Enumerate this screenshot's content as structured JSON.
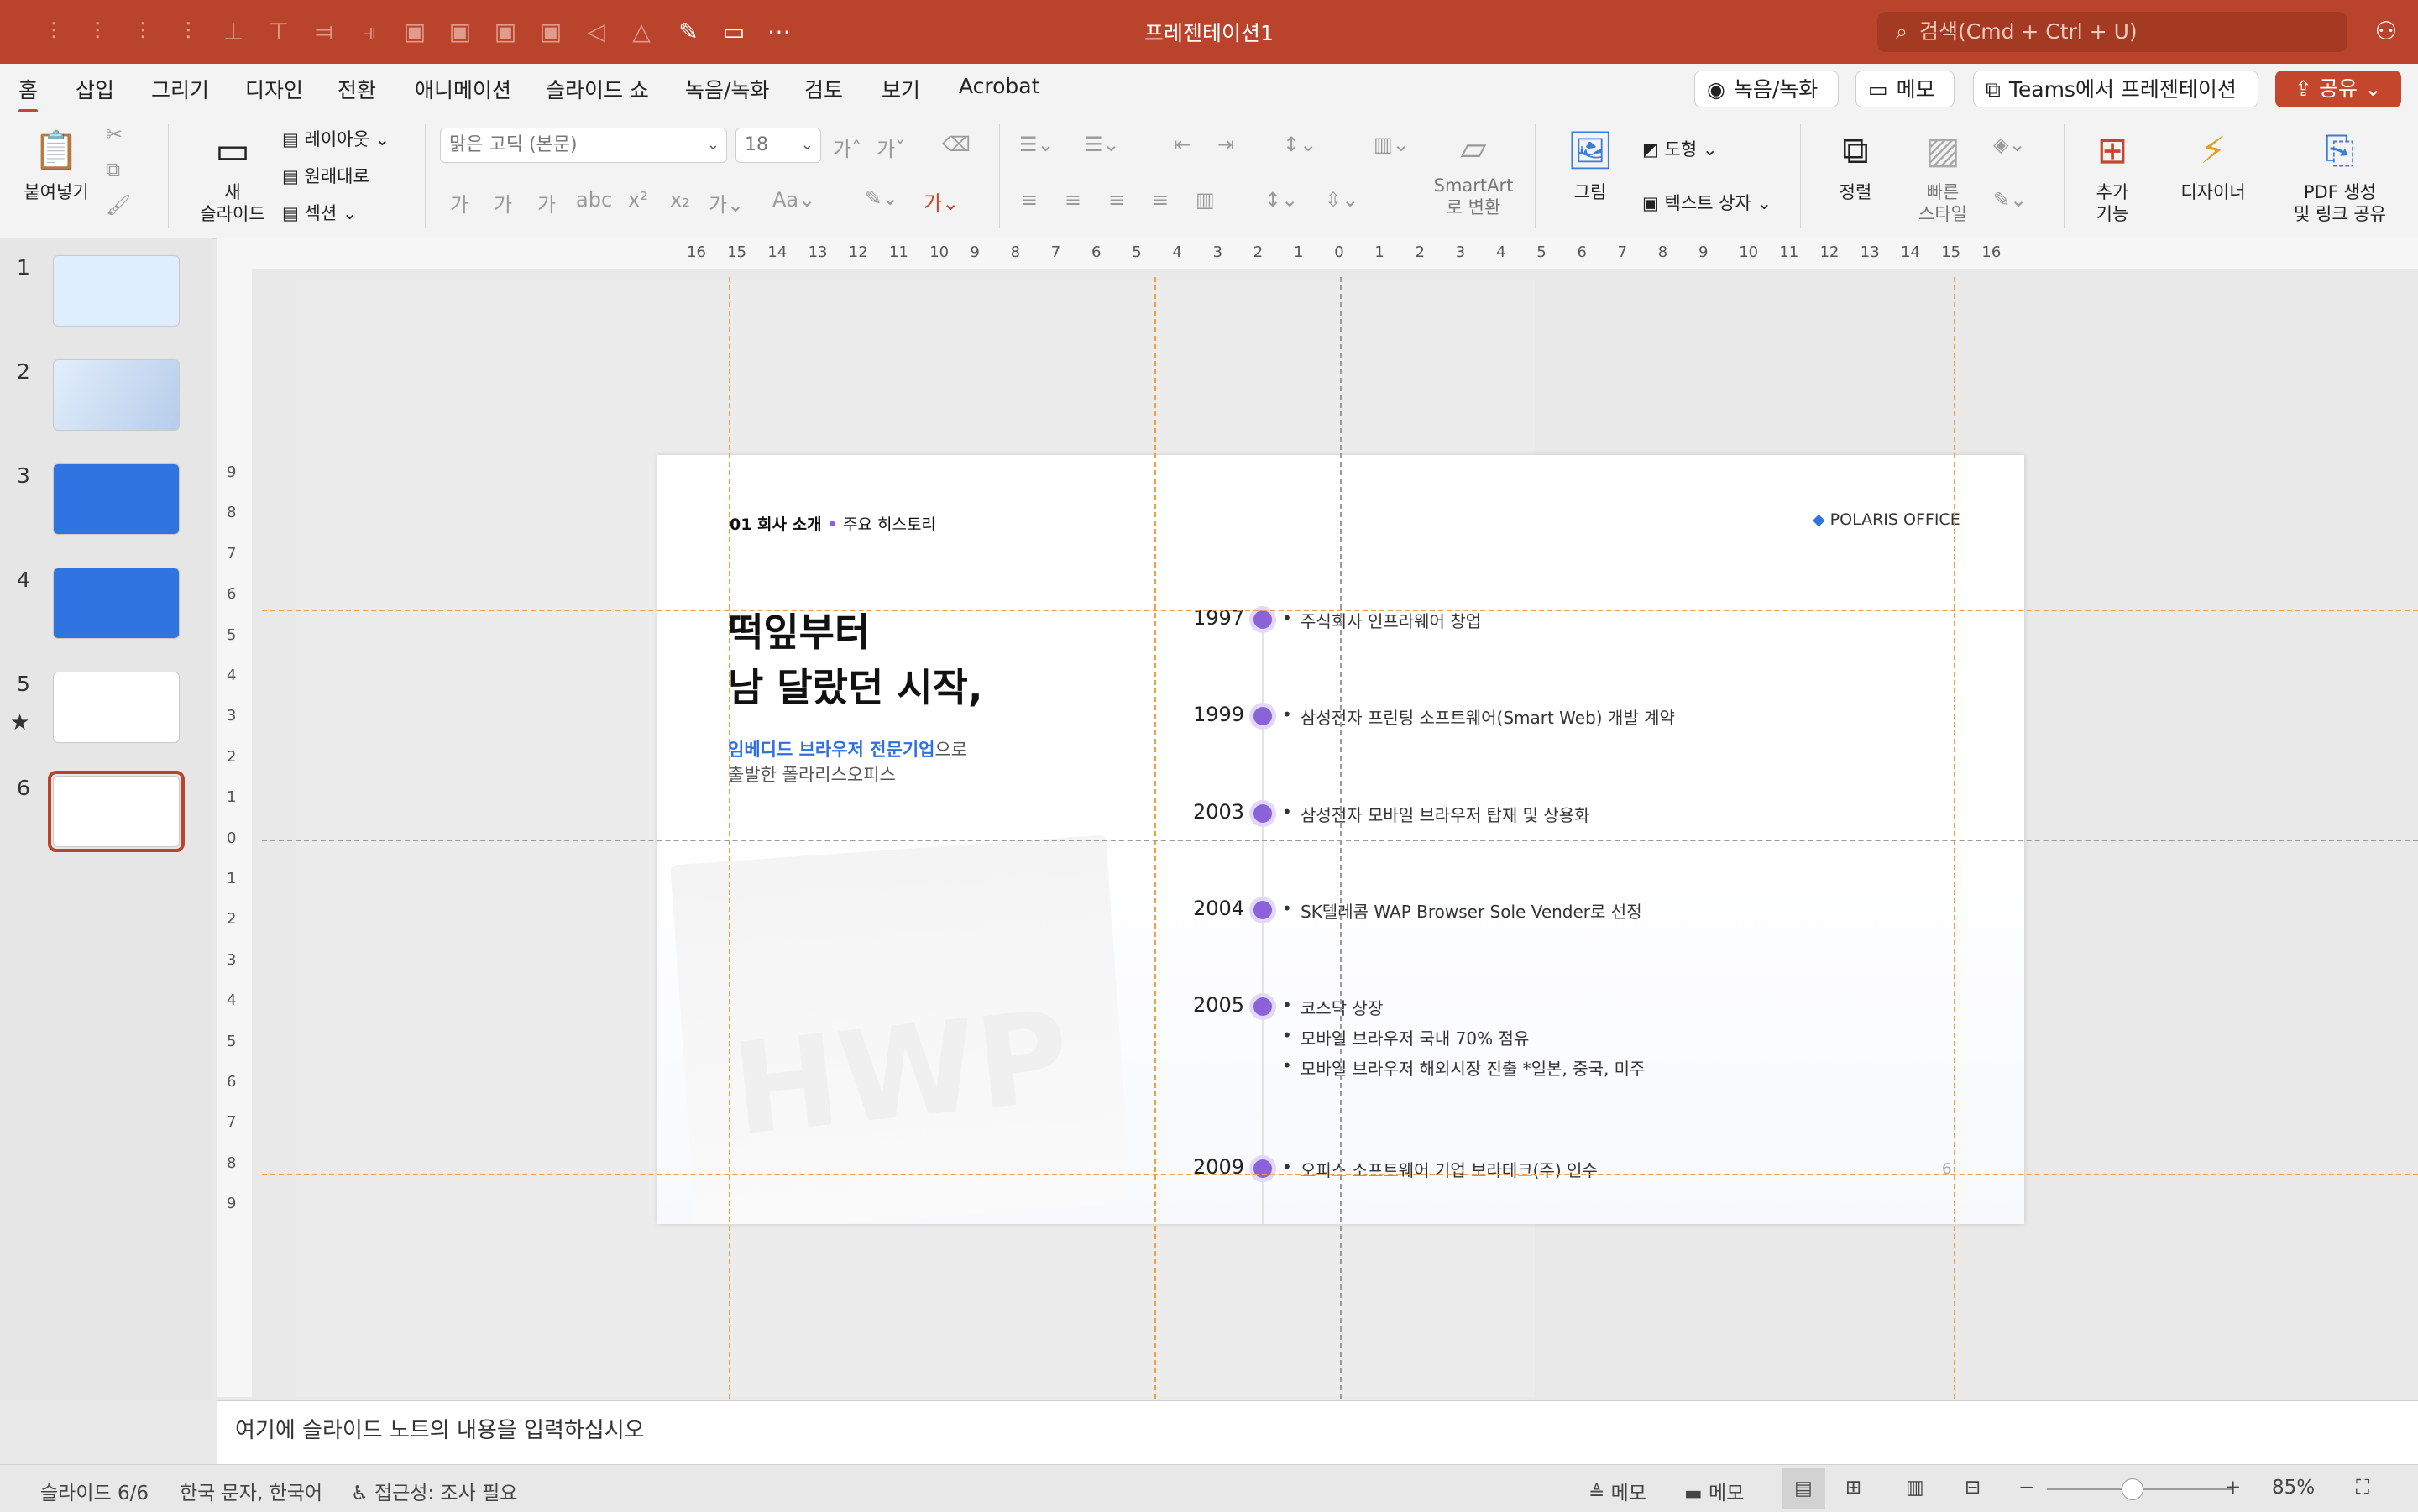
{
  "window": {
    "title": "프레젠테이션1"
  },
  "search": {
    "placeholder": "검색(Cmd + Ctrl + U)"
  },
  "tabs": [
    "홈",
    "삽입",
    "그리기",
    "디자인",
    "전환",
    "애니메이션",
    "슬라이드 쇼",
    "녹음/녹화",
    "검토",
    "보기",
    "Acrobat"
  ],
  "tab_actions": {
    "record": "녹음/녹화",
    "comment": "메모",
    "teams": "Teams에서 프레젠테이션",
    "share": "공유"
  },
  "ribbon": {
    "paste": "붙여넣기",
    "new_slide_1": "새",
    "new_slide_2": "슬라이드",
    "layout": "레이아웃",
    "reset": "원래대로",
    "section": "섹션",
    "font_name": "맑은 고딕 (본문)",
    "font_size": "18",
    "smartart_1": "SmartArt",
    "smartart_2": "로 변환",
    "picture": "그림",
    "shape": "도형",
    "textbox": "텍스트 상자",
    "arrange": "정렬",
    "quick_style_1": "빠른",
    "quick_style_2": "스타일",
    "addins_1": "추가",
    "addins_2": "기능",
    "designer": "디자이너",
    "pdf_1": "PDF 생성",
    "pdf_2": "및 링크 공유"
  },
  "thumbnails": [
    "1",
    "2",
    "3",
    "4",
    "5",
    "6"
  ],
  "ruler": {
    "h_ticks": [
      "16",
      "15",
      "14",
      "13",
      "12",
      "11",
      "10",
      "9",
      "8",
      "7",
      "6",
      "5",
      "4",
      "3",
      "2",
      "1",
      "0",
      "1",
      "2",
      "3",
      "4",
      "5",
      "6",
      "7",
      "8",
      "9",
      "10",
      "11",
      "12",
      "13",
      "14",
      "15",
      "16"
    ],
    "v_ticks": [
      "9",
      "8",
      "7",
      "6",
      "5",
      "4",
      "3",
      "2",
      "1",
      "0",
      "1",
      "2",
      "3",
      "4",
      "5",
      "6",
      "7",
      "8",
      "9"
    ]
  },
  "slide": {
    "breadcrumb_1": "01 회사 소개",
    "breadcrumb_2": "주요 히스토리",
    "logo": "POLARIS OFFICE",
    "headline_1": "떡잎부터",
    "headline_2": "남 달랐던 시작,",
    "sub_highlight": "임베디드 브라우저 전문기업",
    "sub_rest": "으로",
    "sub_line2": "출발한 폴라리스오피스",
    "watermark": "HWP",
    "page_number": "6",
    "timeline": [
      {
        "year": "1997",
        "items": [
          "주식회사 인프라웨어 창업"
        ]
      },
      {
        "year": "1999",
        "items": [
          "삼성전자 프린팅 소프트웨어(Smart Web) 개발 계약"
        ]
      },
      {
        "year": "2003",
        "items": [
          "삼성전자 모바일 브라우저 탑재 및 상용화"
        ]
      },
      {
        "year": "2004",
        "items": [
          "SK텔레콤 WAP Browser Sole Vender로 선정"
        ]
      },
      {
        "year": "2005",
        "items": [
          "코스닥 상장",
          "모바일 브라우저 국내 70% 점유",
          "모바일 브라우저 해외시장 진출 *일본, 중국, 미주"
        ]
      },
      {
        "year": "2009",
        "items": [
          "오피스 소프트웨어 기업 보라테크(주) 인수"
        ]
      }
    ]
  },
  "notes": {
    "placeholder": "여기에 슬라이드 노트의 내용을 입력하십시오"
  },
  "status": {
    "slide": "슬라이드 6/6",
    "language": "한국 문자, 한국어",
    "accessibility": "접근성: 조사 필요",
    "notes": "메모",
    "comments": "메모",
    "zoom": "85%",
    "zoom_level": 0.46
  },
  "colors": {
    "accent": "#b9442b",
    "timeline_dot": "#8a63d8",
    "highlight_text": "#2f6fe0"
  }
}
